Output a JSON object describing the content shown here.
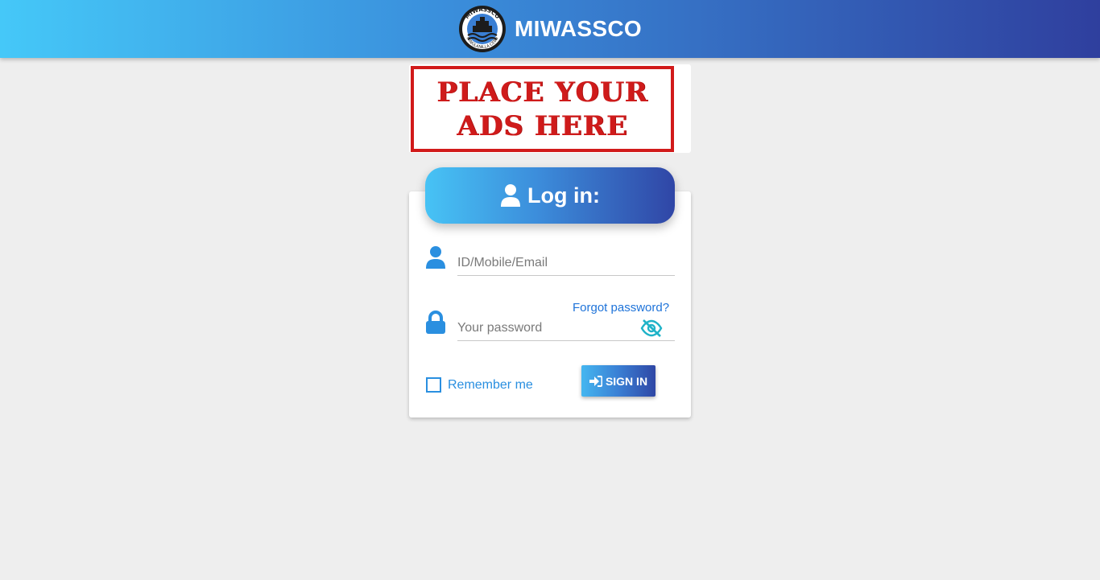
{
  "header": {
    "brand_name": "MIWASSCO",
    "logo_text_top": "MIWASSCO",
    "logo_text_bottom": "MINGLANILLA CEBU"
  },
  "ad": {
    "line1": "PLACE YOUR",
    "line2": "ADS HERE"
  },
  "login": {
    "title": "Log in:",
    "id_placeholder": "ID/Mobile/Email",
    "password_placeholder": "Your password",
    "forgot_label": "Forgot password?",
    "remember_label": "Remember me",
    "signin_label": "SIGN IN"
  },
  "icons": {
    "user": "user-icon",
    "lock": "lock-icon",
    "eye": "eye-slash-icon",
    "signin": "sign-in-icon"
  },
  "colors": {
    "accent": "#2a8fe0",
    "header_start": "#45c8f8",
    "header_end": "#2f3f9e",
    "ad_red": "#cf1b1b"
  }
}
